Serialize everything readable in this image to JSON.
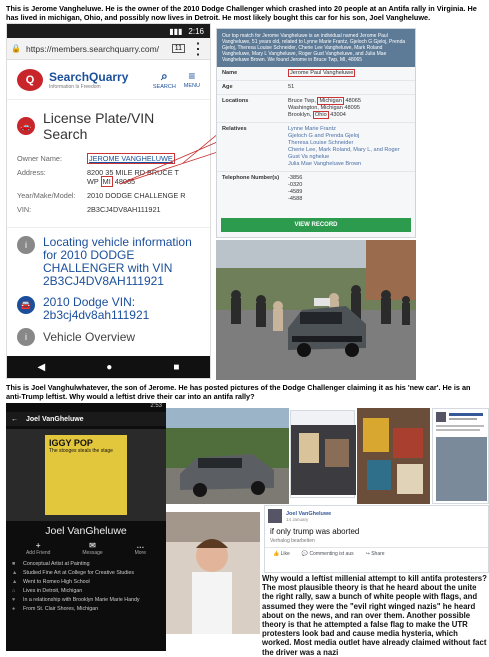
{
  "caption_top": "This is Jerome Vangheluwe. He is the owner of the 2010 Dodge Challenger which crashed into 20 people at an Antifa rally in Virginia. He has lived in michigan, Ohio, and possibly now lives in Detroit. He most likely bought this car for his son, Joel Vangheluwe.",
  "caption_mid": "This is Joel Vanghulwhatever, the son of Jerome. He has posted pictures of the Dodge Challenger claiming it as his 'new car'. He is an anti-Trump leftist. Why would a leftist drive their car into an antifa rally?",
  "phone1": {
    "time": "2:16",
    "url": "https://members.searchquarry.com/",
    "tabs": "11",
    "logo_text": "SearchQuarry",
    "logo_tag": "Information Is Freedom",
    "nav_search": "SEARCH",
    "nav_menu": "MENU",
    "section_title": "License Plate/VIN Search",
    "owner_label": "Owner Name:",
    "owner_value": "JEROME VANGHELUWE",
    "address_label": "Address:",
    "address_line1": "8200 35 MILE RD BRUCE T",
    "address_wp": "WP",
    "address_state": "MI",
    "address_zip": "48065",
    "ymm_label": "Year/Make/Model:",
    "ymm_value": "2010 DODGE CHALLENGE R",
    "vin_label": "VIN:",
    "vin_value": "2B3CJ4DV8AH111921",
    "locating_text": "Locating vehicle information for 2010 DODGE CHALLENGER with VIN 2B3CJ4DV8AH111921",
    "vin_title": "2010 Dodge VIN:",
    "vin_lower": "2b3cj4dv8ah111921",
    "overview": "Vehicle Overview"
  },
  "card": {
    "header": "Our top match for Jerome Vangheluwe is an individual named Jerome Paul Vangheluwe, 51 years old, related to Lynne Marie Frantz, Gjeloch G Gjeloj, Prenda Gjeloj, Theresa Louise Schneider, Cherie Lee Vangheluwe, Mark Roland Vangheluwe, Mary L Vangheluwe, Roger Gust Vangheluwe, and Julia Mae Vangheluwe Brown. We found Jerome in Bruce Twp, MI, 48065",
    "name_label": "Name",
    "name_value": "Jerome Paul Vangheluwe",
    "age_label": "Age",
    "age_value": "51",
    "loc_label": "Locations",
    "loc1_pre": "Bruce Twp,",
    "loc1_state": "Michigan",
    "loc1_zip": "48065",
    "loc2": "Washington, Michigan 48095",
    "loc3_pre": "Brooklyn,",
    "loc3_state": "Ohio",
    "loc3_zip": "43004",
    "rel_label": "Relatives",
    "relatives": "Lynne Marie Frantz\nGjeloch G and Prenda Gjeloj\nTheresa Louise Schneider\nCherie Lee, Mark Roland, Mary L, and Roger Gust Va nghelue\nJulia Mae Vangheluwe Brown",
    "tel_label": "Telephone Number(s)",
    "tel1": "-3856",
    "tel2": "-0320",
    "tel3": "-4589",
    "tel4": "-4588",
    "button": "VIEW RECORD"
  },
  "phone2": {
    "time": "2:53",
    "title": "Joel VanGheluwe",
    "album_title": "IGGY POP",
    "album_sub": "The stooges steals the stage",
    "name": "Joel VanGheluwe",
    "act1": "Add Friend",
    "act2": "Message",
    "act3": "More",
    "items": [
      "Conceptual Artist at Painting",
      "Studied Fine Art at College for Creative Studies",
      "Went to Romeo High School",
      "Lives in Detroit, Michigan",
      "In a relationship with Brooklyn Marie Marie Handy",
      "From St. Clair Shores, Michigan"
    ]
  },
  "fb_post": {
    "name": "Joel VanGheluwe",
    "time": "14 January",
    "text": "if only trump was aborted",
    "meta": "Verhalog bearbeiten",
    "like": "Like",
    "comment": "Commenting ist aus",
    "share": "Share"
  },
  "quote": "Why would a leftist millenial attempt to kill antifa protesters? The most plausible theory is that he heard about the unite the right rally, saw a bunch of white people with flags, and assumed they were the \"evil right winged nazis\" he heard about on the news, and ran over them. Another possible theory is that he attempted a false flag to make the UTR protesters look bad and cause media hysteria, which worked. Most media outlet have already claimed without fact the driver was a nazi"
}
